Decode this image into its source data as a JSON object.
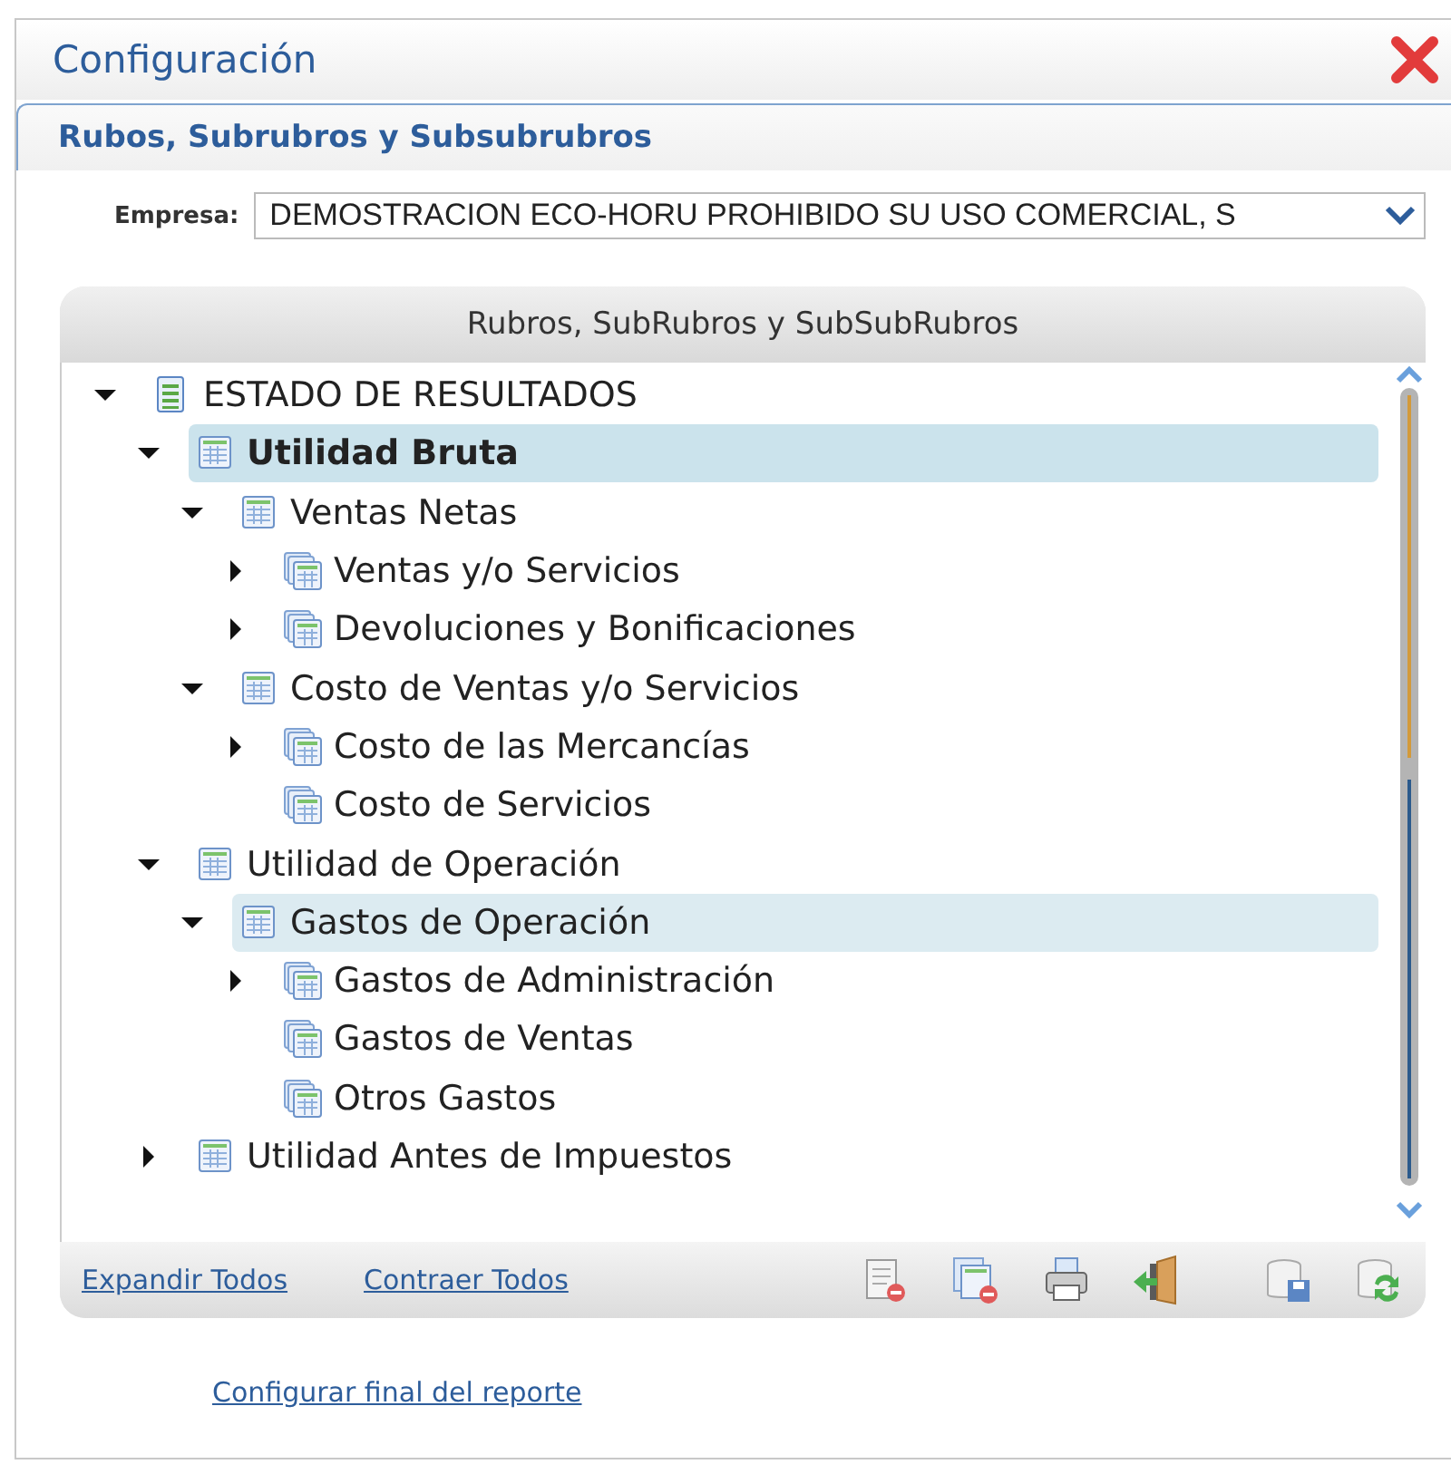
{
  "window": {
    "title": "Configuración"
  },
  "tab": {
    "label": "Rubos, Subrubros y Subsubrubros"
  },
  "company": {
    "label": "Empresa:",
    "value": "DEMOSTRACION ECO-HORU PROHIBIDO SU USO COMERCIAL, S"
  },
  "tree_panel": {
    "title": "Rubros, SubRubros y SubSubRubros",
    "items": [
      {
        "label": "ESTADO DE RESULTADOS",
        "kind": "report",
        "expandable": true,
        "expanded": true,
        "selected": false,
        "hovered": false,
        "children": [
          {
            "label": "Utilidad Bruta",
            "kind": "table",
            "expandable": true,
            "expanded": true,
            "selected": true,
            "hovered": false,
            "children": [
              {
                "label": "Ventas Netas",
                "kind": "table",
                "expandable": true,
                "expanded": true,
                "selected": false,
                "hovered": false,
                "children": [
                  {
                    "label": "Ventas y/o Servicios",
                    "kind": "tables",
                    "expandable": true,
                    "expanded": false,
                    "selected": false,
                    "hovered": false
                  },
                  {
                    "label": "Devoluciones y Bonificaciones",
                    "kind": "tables",
                    "expandable": true,
                    "expanded": false,
                    "selected": false,
                    "hovered": false
                  }
                ]
              },
              {
                "label": "Costo de Ventas y/o Servicios",
                "kind": "table",
                "expandable": true,
                "expanded": true,
                "selected": false,
                "hovered": false,
                "children": [
                  {
                    "label": "Costo de las Mercancías",
                    "kind": "tables",
                    "expandable": true,
                    "expanded": false,
                    "selected": false,
                    "hovered": false
                  },
                  {
                    "label": "Costo de Servicios",
                    "kind": "tables",
                    "expandable": false,
                    "selected": false,
                    "hovered": false
                  }
                ]
              }
            ]
          },
          {
            "label": "Utilidad de Operación",
            "kind": "table",
            "expandable": true,
            "expanded": true,
            "selected": false,
            "hovered": false,
            "children": [
              {
                "label": "Gastos de Operación",
                "kind": "table",
                "expandable": true,
                "expanded": true,
                "selected": false,
                "hovered": true,
                "children": [
                  {
                    "label": "Gastos de Administración",
                    "kind": "tables",
                    "expandable": true,
                    "expanded": false,
                    "selected": false,
                    "hovered": false
                  },
                  {
                    "label": "Gastos de Ventas",
                    "kind": "tables",
                    "expandable": false,
                    "selected": false,
                    "hovered": false
                  },
                  {
                    "label": "Otros Gastos",
                    "kind": "tables",
                    "expandable": false,
                    "selected": false,
                    "hovered": false
                  }
                ]
              }
            ]
          },
          {
            "label": "Utilidad Antes de Impuestos",
            "kind": "table",
            "expandable": true,
            "expanded": false,
            "selected": false,
            "hovered": false
          }
        ]
      }
    ],
    "links": [
      "Expandir Todos",
      "Contraer Todos"
    ]
  },
  "footer_link": "Configurar final del reporte"
}
